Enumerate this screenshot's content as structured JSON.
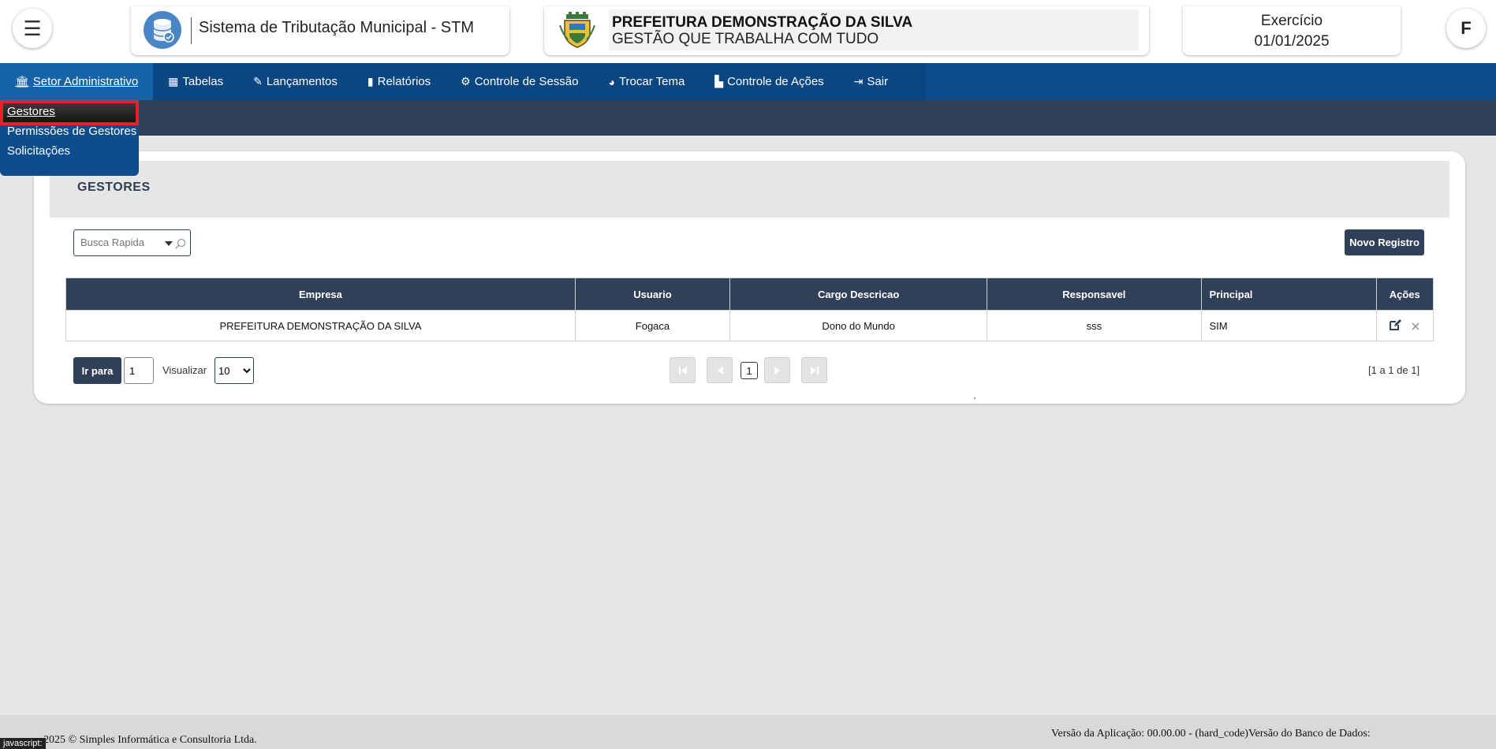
{
  "header": {
    "menu_icon": "☰",
    "system_title": "Sistema de Tributação Municipal - STM",
    "prefeitura_name": "PREFEITURA DEMONSTRAÇÃO DA SILVA",
    "prefeitura_slogan": "GESTÃO QUE TRABALHA COM TUDO",
    "exercicio_label": "Exercício",
    "exercicio_date": "01/01/2025",
    "user_initial": "F"
  },
  "nav": {
    "items": [
      {
        "label": "Setor Administrativo",
        "icon": "bank-icon"
      },
      {
        "label": "Tabelas",
        "icon": "table-icon"
      },
      {
        "label": "Lançamentos",
        "icon": "edit-icon"
      },
      {
        "label": "Relatórios",
        "icon": "book-icon"
      },
      {
        "label": "Controle de Sessão",
        "icon": "gear-icon"
      },
      {
        "label": "Trocar Tema",
        "icon": "palette-icon"
      },
      {
        "label": "Controle de Ações",
        "icon": "chart-icon"
      },
      {
        "label": "Sair",
        "icon": "sign-out-icon"
      }
    ]
  },
  "dropdown": {
    "items": [
      "Gestores",
      "Permissões de Gestores",
      "Solicitações"
    ]
  },
  "panel": {
    "title": "GESTORES",
    "search_placeholder": "Busca Rapida",
    "new_button": "Novo Registro"
  },
  "table": {
    "columns": [
      "Empresa",
      "Usuario",
      "Cargo Descricao",
      "Responsavel",
      "Principal",
      "Ações"
    ],
    "rows": [
      {
        "empresa": "PREFEITURA DEMONSTRAÇÃO DA SILVA",
        "usuario": "Fogaca",
        "cargo": "Dono do Mundo",
        "responsavel": "sss",
        "principal": "SIM"
      }
    ]
  },
  "pagination": {
    "goto_label": "Ir para",
    "goto_value": "1",
    "view_label": "Visualizar",
    "view_value": "10",
    "current_page": "1",
    "count_text": "[1 a 1 de 1]"
  },
  "footer": {
    "copyright": "2025 © Simples Informática e Consultoria Ltda.",
    "version": "Versão da Aplicação: 00.00.00 - (hard_code)Versão do Banco de Dados:",
    "status_text": "javascript:"
  },
  "colors": {
    "nav_bg": "#0a4682",
    "header_dark": "#2f4058",
    "highlight": "#e8202a"
  }
}
